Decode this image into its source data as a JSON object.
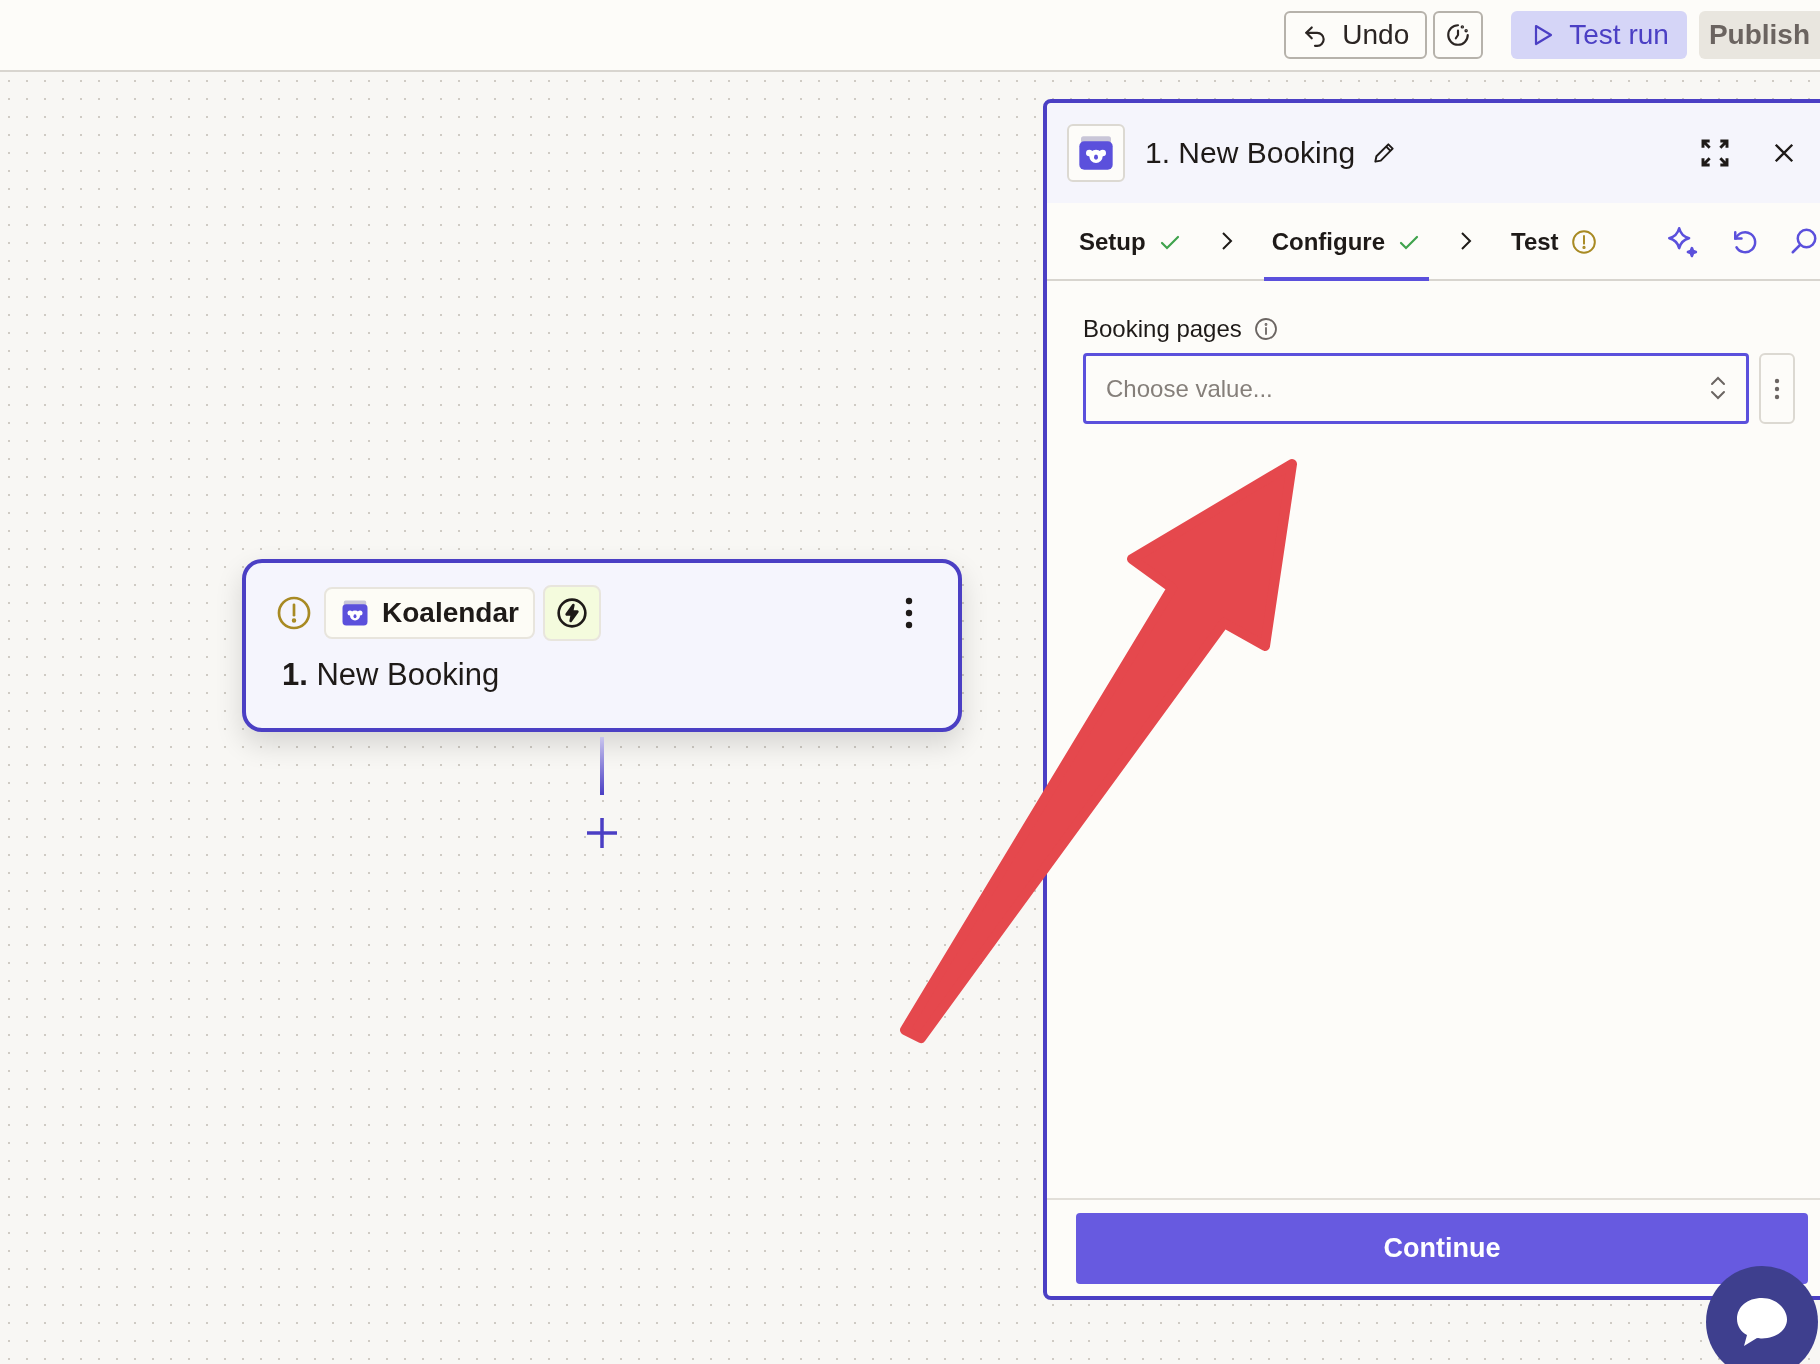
{
  "toolbar": {
    "undo": "Undo",
    "test_run": "Test run",
    "publish": "Publish"
  },
  "node": {
    "warning": true,
    "app": "Koalendar",
    "title": "**1.** New Booking"
  },
  "panel": {
    "title": "1. New Booking",
    "tabs": [
      {
        "label": "Setup",
        "complete": true,
        "selected": false
      },
      {
        "label": "Configure",
        "complete": true,
        "selected": true
      },
      {
        "label": "Test",
        "complete": false,
        "selected": false
      }
    ],
    "field": {
      "label": "Booking pages",
      "placeholder": "Choose value..."
    },
    "continue": "Continue"
  }
}
